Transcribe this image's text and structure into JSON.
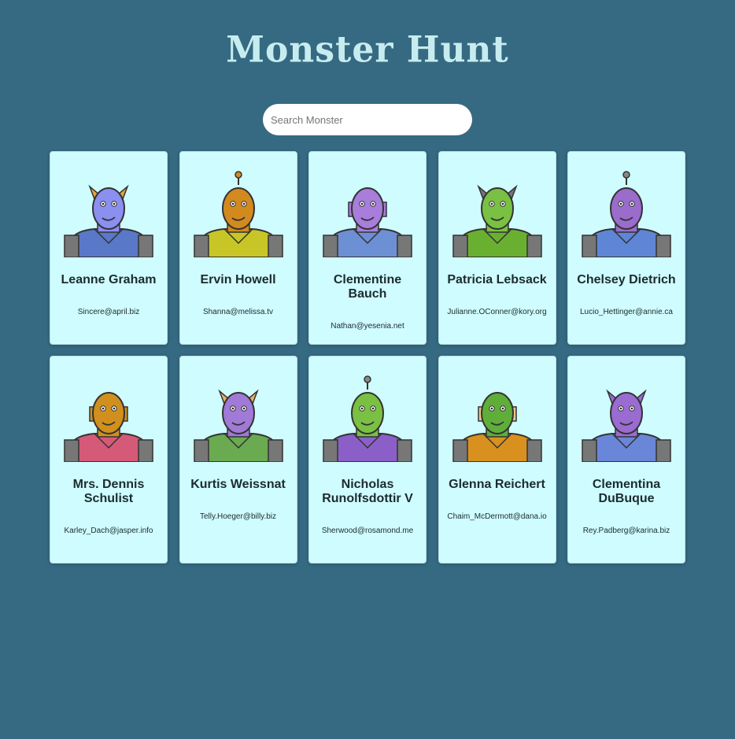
{
  "header": {
    "title": "Monster Hunt"
  },
  "search": {
    "placeholder": "Search Monster",
    "value": ""
  },
  "monsters": [
    {
      "name": "Leanne Graham",
      "email": "Sincere@april.biz",
      "skin": "#8a8ff0",
      "suit": "#5a78c8",
      "horns": "#e5a43a"
    },
    {
      "name": "Ervin Howell",
      "email": "Shanna@melissa.tv",
      "skin": "#d28a1f",
      "suit": "#c8c627",
      "horns": "#d28a1f"
    },
    {
      "name": "Clementine Bauch",
      "email": "Nathan@yesenia.net",
      "skin": "#a87ddb",
      "suit": "#6d8fd4",
      "horns": "#a87ddb"
    },
    {
      "name": "Patricia Lebsack",
      "email": "Julianne.OConner@kory.org",
      "skin": "#7ac143",
      "suit": "#6ab030",
      "horns": "#777777"
    },
    {
      "name": "Chelsey Dietrich",
      "email": "Lucio_Hettinger@annie.ca",
      "skin": "#9a6ccc",
      "suit": "#5f86d6",
      "horns": "#888888"
    },
    {
      "name": "Mrs. Dennis Schulist",
      "email": "Karley_Dach@jasper.info",
      "skin": "#d1901d",
      "suit": "#d55a78",
      "horns": "#d1901d"
    },
    {
      "name": "Kurtis Weissnat",
      "email": "Telly.Hoeger@billy.biz",
      "skin": "#a07ad6",
      "suit": "#6aaa50",
      "horns": "#e8b06a"
    },
    {
      "name": "Nicholas Runolfsdottir V",
      "email": "Sherwood@rosamond.me",
      "skin": "#7ac143",
      "suit": "#8a60c8",
      "horns": "#888888"
    },
    {
      "name": "Glenna Reichert",
      "email": "Chaim_McDermott@dana.io",
      "skin": "#5fae3a",
      "suit": "#d8911f",
      "horns": "#e8c98a"
    },
    {
      "name": "Clementina DuBuque",
      "email": "Rey.Padberg@karina.biz",
      "skin": "#9a6cd2",
      "suit": "#6a86d8",
      "horns": "#9a6cd2"
    }
  ]
}
